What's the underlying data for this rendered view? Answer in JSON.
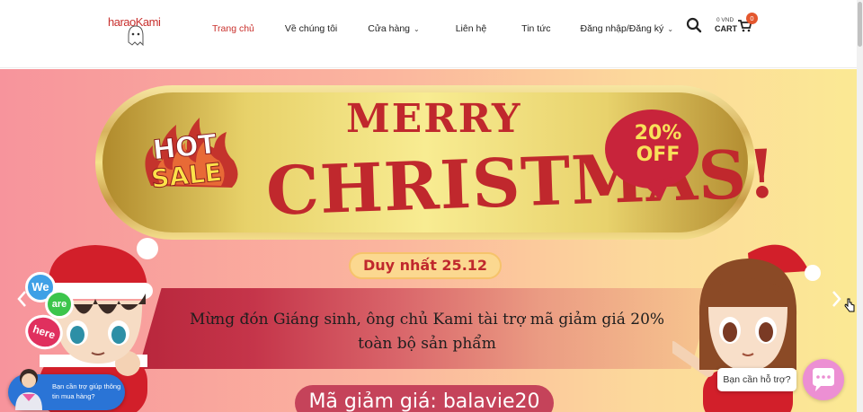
{
  "header": {
    "logo_text": "haraoKami",
    "nav": [
      {
        "label": "Trang chủ",
        "active": true,
        "dropdown": false
      },
      {
        "label": "Về chúng tôi",
        "active": false,
        "dropdown": false
      },
      {
        "label": "Cửa hàng",
        "active": false,
        "dropdown": true
      },
      {
        "label": "Liên hệ",
        "active": false,
        "dropdown": false
      },
      {
        "label": "Tin tức",
        "active": false,
        "dropdown": false
      },
      {
        "label": "Đăng nhập/Đăng ký",
        "active": false,
        "dropdown": true
      }
    ],
    "search_icon": "search-icon",
    "cart": {
      "amount": "0 VND",
      "label": "CART",
      "count": "0"
    }
  },
  "hero": {
    "hot": "HOT",
    "sale": "SALE",
    "merry": "MERRY",
    "christmas": "CHRISTMAS!",
    "off_line1": "20%",
    "off_line2": "OFF",
    "date": "Duy nhất 25.12",
    "message": "Mừng đón Giáng sinh, ông chủ Kami tài trợ mã giảm giá 20% toàn bộ sản phẩm",
    "coupon": "Mã giảm giá: balavie20",
    "badges": [
      "We",
      "are",
      "here"
    ],
    "prev_icon": "chevron-left-icon",
    "next_icon": "chevron-right-icon"
  },
  "chat": {
    "left_text": "Bạn cần trợ giúp thông tin mua hàng?",
    "help_text": "Bạn cần hỗ trợ?",
    "help_icon": "chat-bubble-icon"
  },
  "colors": {
    "accent": "#c9302c",
    "hero_red": "#c0282d",
    "badge": "#e4572e",
    "help": "#ec8fd3"
  }
}
